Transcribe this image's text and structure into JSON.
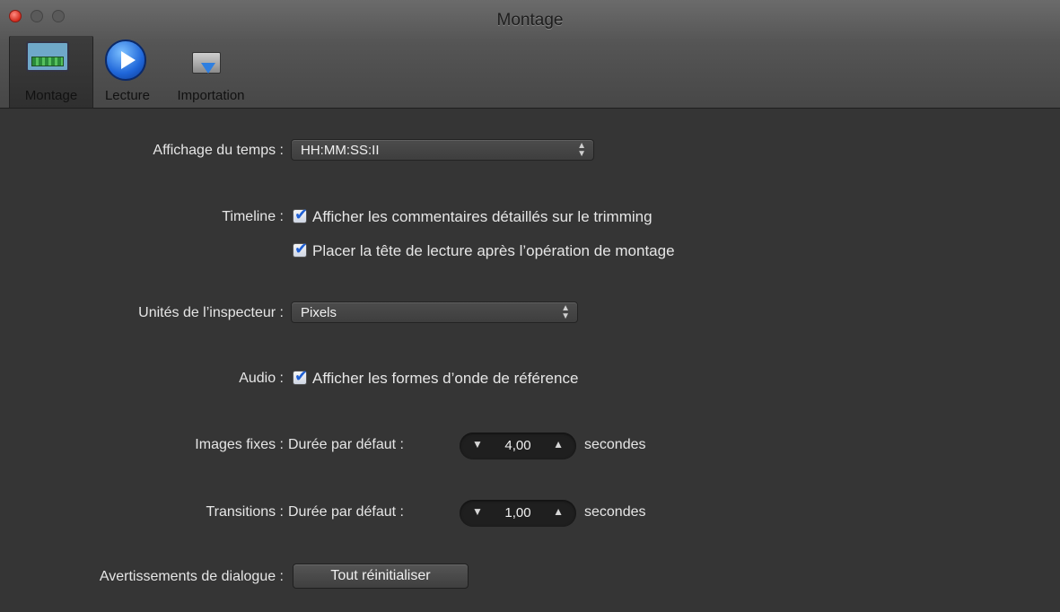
{
  "window": {
    "title": "Montage",
    "controls": [
      "close-button",
      "minimize-button",
      "zoom-button"
    ]
  },
  "toolbar": {
    "items": [
      {
        "label": "Montage",
        "icon": "montage-icon",
        "selected": true
      },
      {
        "label": "Lecture",
        "icon": "play-icon",
        "selected": false
      },
      {
        "label": "Importation",
        "icon": "import-camera-icon",
        "selected": false
      }
    ]
  },
  "settings": {
    "time_display": {
      "label": "Affichage du temps :",
      "value": "HH:MM:SS:II"
    },
    "timeline": {
      "label": "Timeline :",
      "options": [
        {
          "label": "Afficher les commentaires détaillés sur le trimming",
          "checked": true
        },
        {
          "label": "Placer la tête de lecture après l’opération de montage",
          "checked": true
        }
      ]
    },
    "inspector_units": {
      "label": "Unités de l’inspecteur :",
      "value": "Pixels"
    },
    "audio": {
      "label": "Audio :",
      "option": {
        "label": "Afficher les formes d’onde de référence",
        "checked": true
      }
    },
    "still_images": {
      "label": "Images fixes :",
      "duration_label": "Durée par défaut :",
      "value": "4,00",
      "unit": "secondes"
    },
    "transitions": {
      "label": "Transitions :",
      "duration_label": "Durée par défaut :",
      "value": "1,00",
      "unit": "secondes"
    },
    "dialog_warnings": {
      "label": "Avertissements de dialogue :",
      "button": "Tout réinitialiser"
    }
  }
}
